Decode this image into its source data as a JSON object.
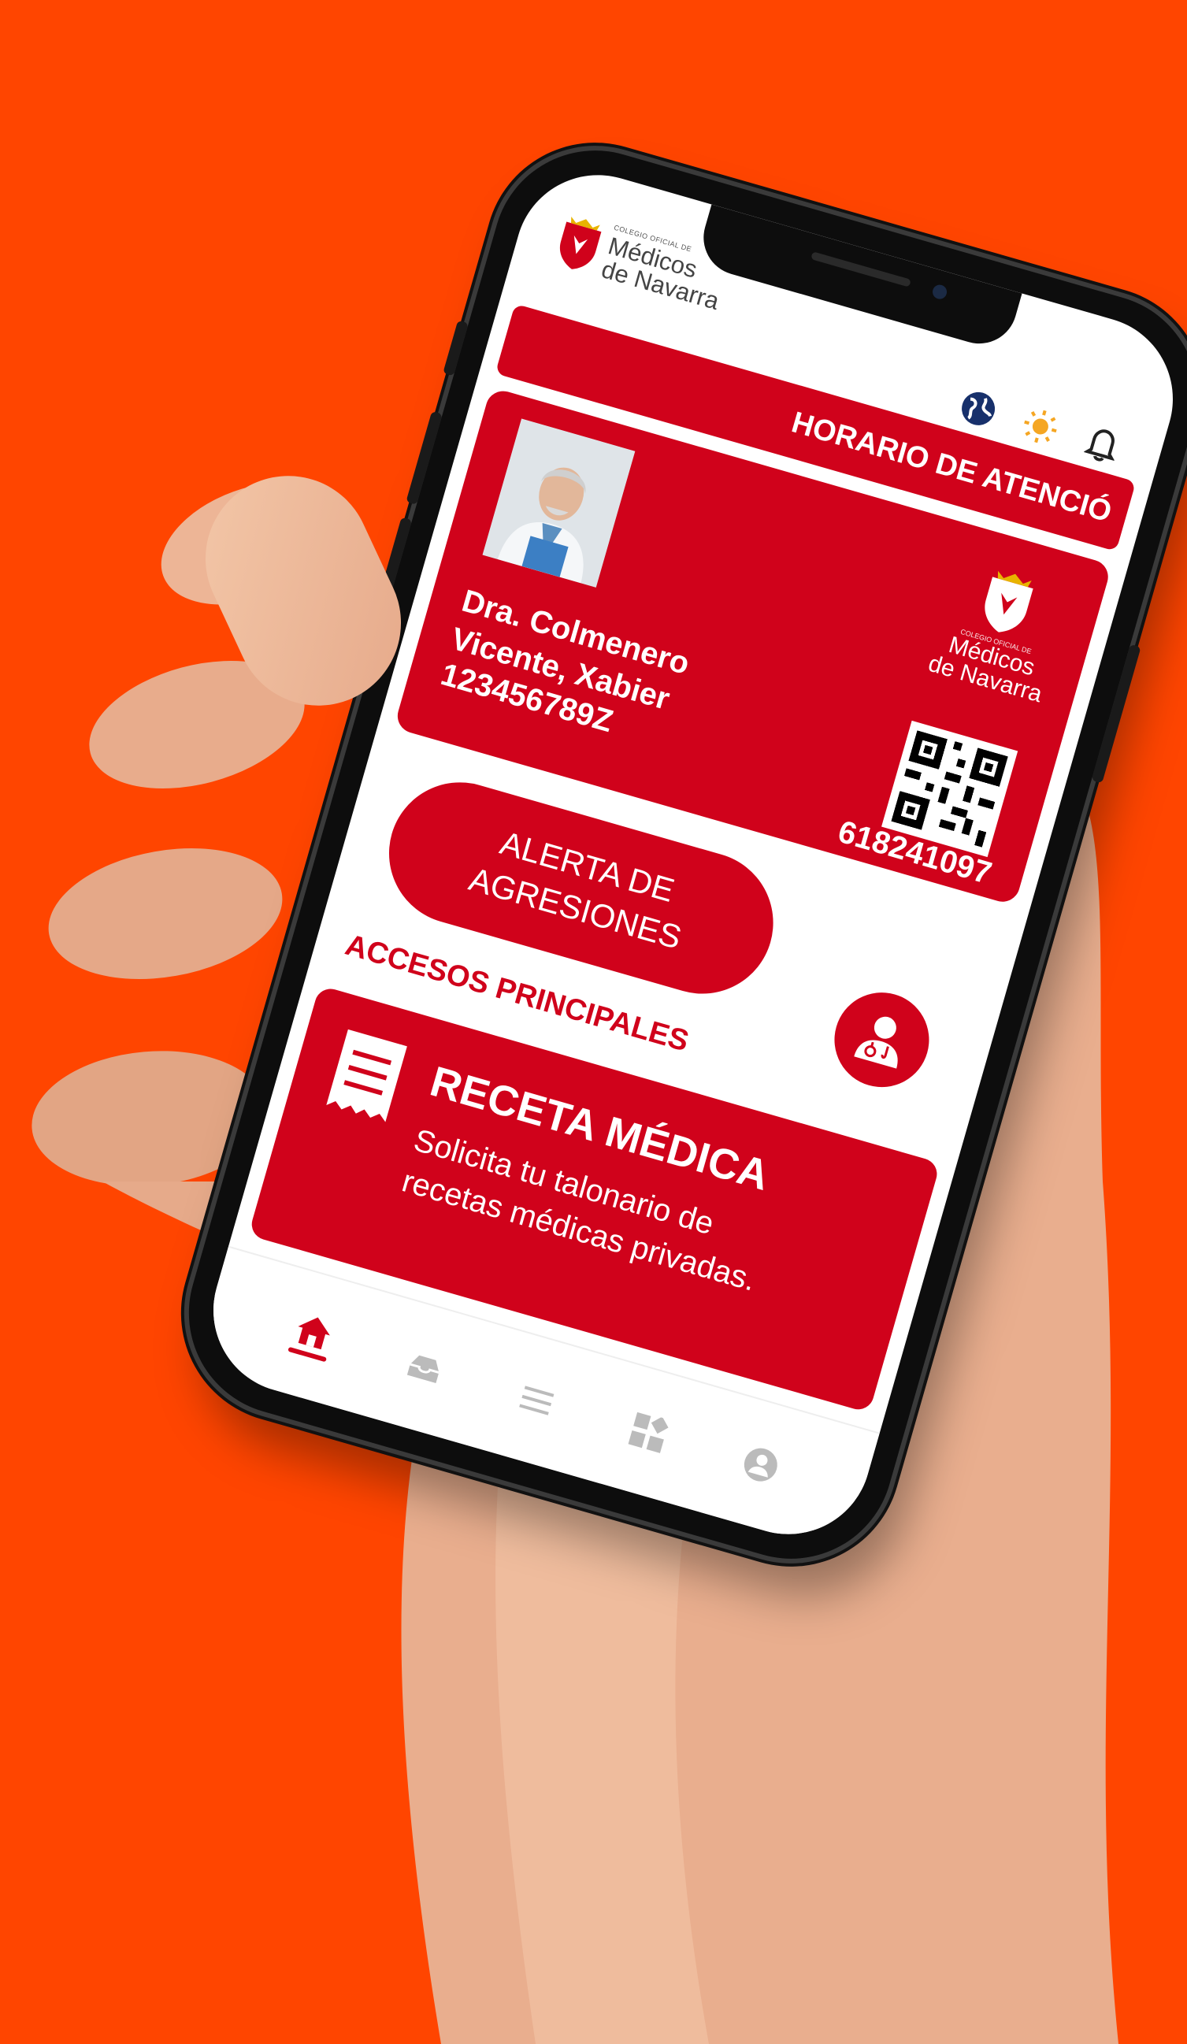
{
  "header": {
    "logo_small": "COLEGIO OFICIAL DE",
    "logo_line1": "Médicos",
    "logo_line2": "de Navarra",
    "icons": [
      "globe-icon",
      "sun-icon",
      "bell-icon"
    ]
  },
  "banner": {
    "text": "HORARIO DE ATENCIÓ"
  },
  "card": {
    "name_line1": "Dra. Colmenero",
    "name_line2": "Vicente, Xabier",
    "dni": "123456789Z",
    "logo_small": "COLEGIO OFICIAL DE",
    "logo_line1": "Médicos",
    "logo_line2": "de Navarra",
    "member_number": "618241097"
  },
  "alert_button": {
    "label": "ALERTA DE AGRESIONES"
  },
  "section": {
    "title": "ACCESOS PRINCIPALES"
  },
  "receta": {
    "title": "RECETA MÉDICA",
    "description": "Solicita tu talonario de recetas médicas privadas."
  },
  "bottom_nav": {
    "items": [
      "home-icon",
      "inbox-icon",
      "menu-icon",
      "apps-icon",
      "profile-icon"
    ],
    "active": 0
  },
  "colors": {
    "background": "#FF4500",
    "brand_red": "#D0021B"
  }
}
